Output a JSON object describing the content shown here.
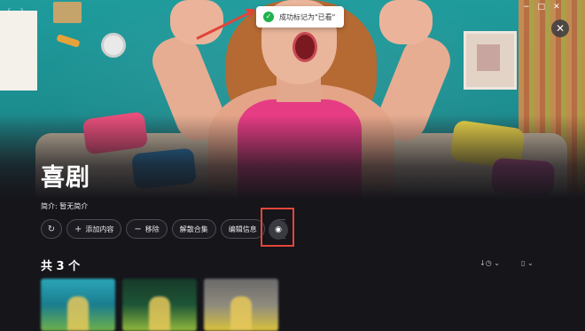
{
  "window": {
    "nav_back_icon": "chevron-left-icon",
    "nav_forward_icon": "chevron-right-icon",
    "controls": [
      "minimize-icon",
      "maximize-icon",
      "close-icon"
    ]
  },
  "toast": {
    "message": "成功标记为\"已看\"",
    "status_color": "#22b14c"
  },
  "collection": {
    "title": "喜剧",
    "intro_label": "简介:",
    "intro_value": "暂无简介"
  },
  "actions": {
    "refresh_icon": "refresh-icon",
    "add_content": "添加内容",
    "remove": "移除",
    "disband": "解散合集",
    "edit_info": "编辑信息",
    "highlight_color": "#e4463a"
  },
  "list": {
    "count_label": "共 3 个",
    "sort_icon": "sort-icon",
    "view_icon": "view-mode-icon",
    "posters": [
      {
        "name": "poster-1"
      },
      {
        "name": "poster-2"
      },
      {
        "name": "poster-3"
      }
    ]
  }
}
